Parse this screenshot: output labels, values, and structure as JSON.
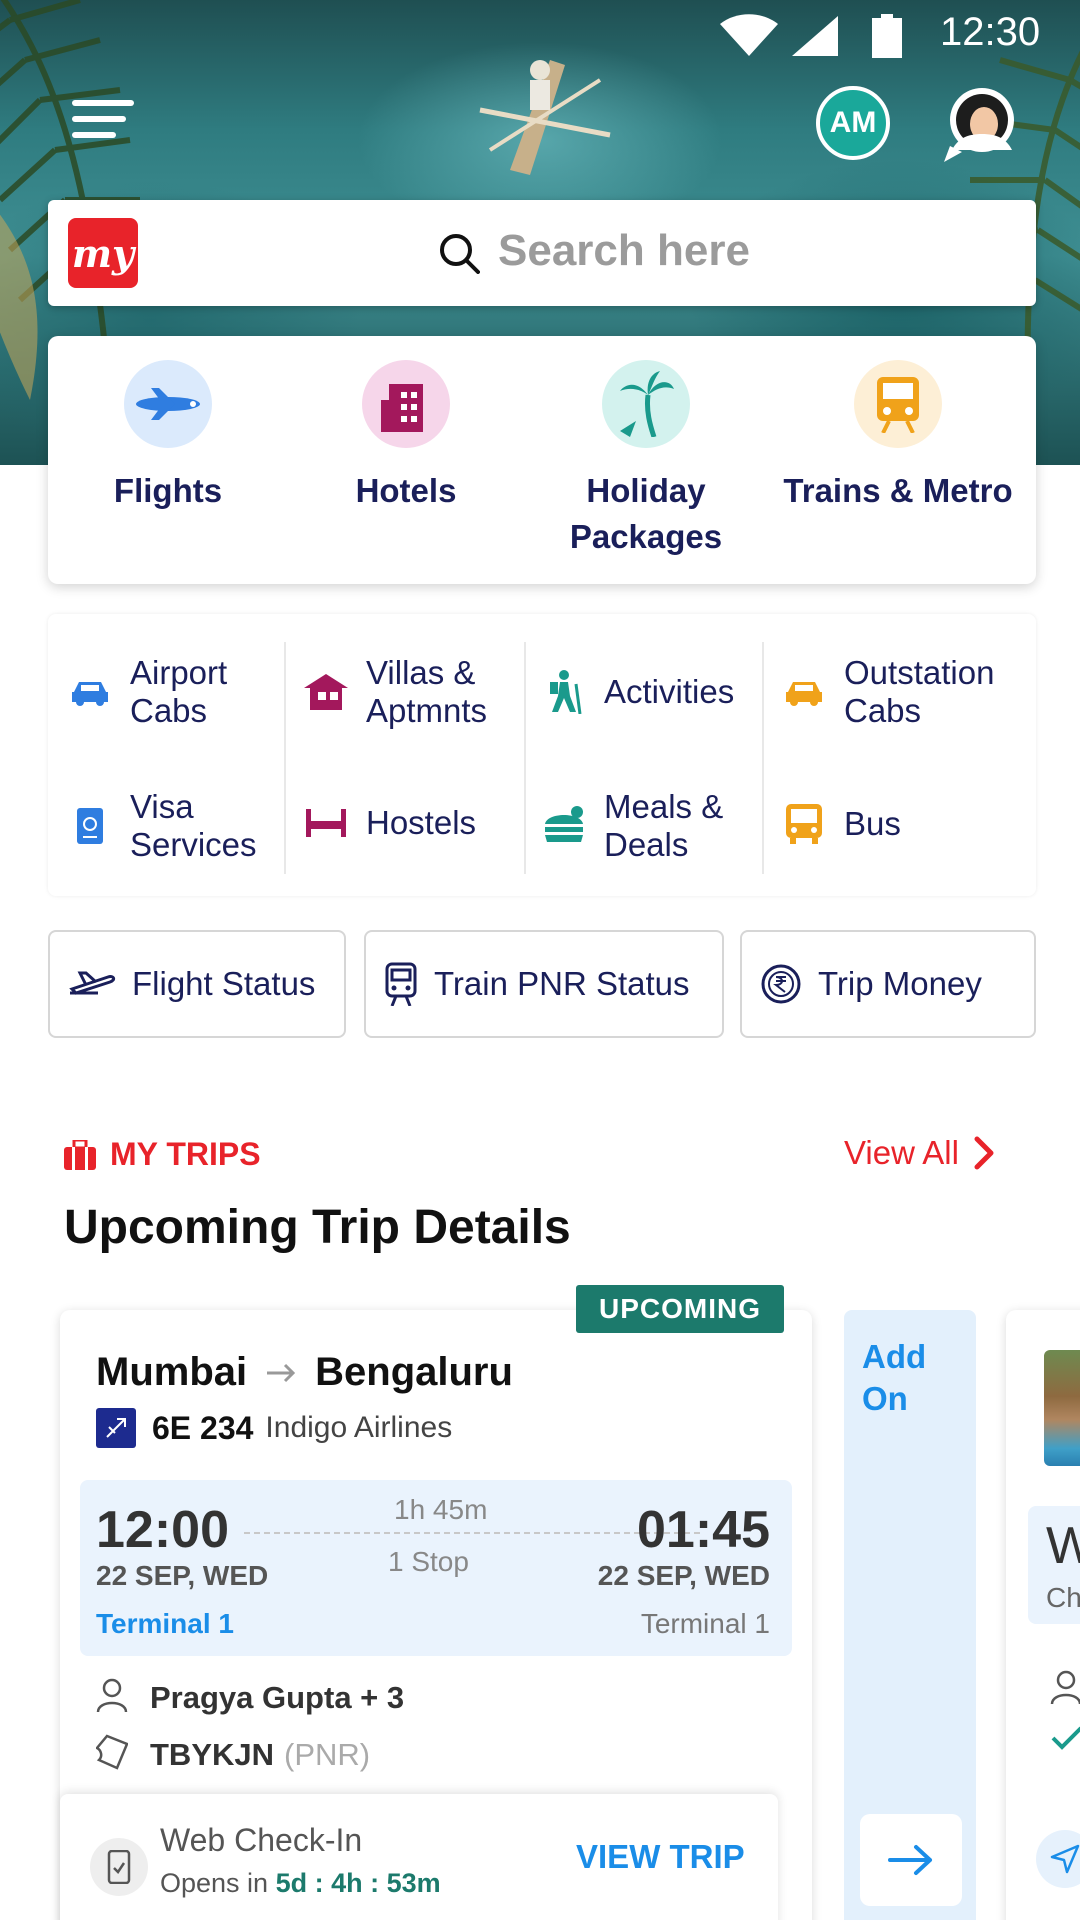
{
  "status_bar": {
    "time": "12:30"
  },
  "header": {
    "avatar_initials": "AM",
    "search": {
      "placeholder": "Search here"
    },
    "logo_text": "my"
  },
  "primary_services": [
    {
      "label": "Flights",
      "icon": "airplane-icon"
    },
    {
      "label": "Hotels",
      "icon": "building-icon"
    },
    {
      "label": "Holiday Packages",
      "icon": "palm-tree-icon"
    },
    {
      "label": "Trains & Metro",
      "icon": "train-icon"
    }
  ],
  "secondary_services": [
    {
      "label": "Airport Cabs",
      "icon": "car-icon"
    },
    {
      "label": "Villas & Aptmnts",
      "icon": "villa-icon"
    },
    {
      "label": "Activities",
      "icon": "hiker-icon"
    },
    {
      "label": "Outstation Cabs",
      "icon": "car-icon"
    },
    {
      "label": "Visa Services",
      "icon": "passport-icon"
    },
    {
      "label": "Hostels",
      "icon": "bed-icon"
    },
    {
      "label": "Meals & Deals",
      "icon": "burger-icon"
    },
    {
      "label": "Bus",
      "icon": "bus-icon"
    }
  ],
  "quick_links": [
    {
      "label": "Flight Status",
      "icon": "flight-status-icon"
    },
    {
      "label": "Train PNR Status",
      "icon": "train-icon"
    },
    {
      "label": "Trip Money",
      "icon": "rupee-icon"
    }
  ],
  "my_trips": {
    "kicker": "MY TRIPS",
    "view_all": "View All",
    "title": "Upcoming Trip Details",
    "trip": {
      "badge": "UPCOMING",
      "from": "Mumbai",
      "to": "Bengaluru",
      "flight_no": "6E 234",
      "airline": "Indigo Airlines",
      "departure": {
        "time": "12:00",
        "date": "22 SEP, WED",
        "terminal": "Terminal 1"
      },
      "arrival": {
        "time": "01:45",
        "date": "22 SEP, WED",
        "terminal": "Terminal 1"
      },
      "duration": "1h 45m",
      "stops": "1 Stop",
      "passengers": "Pragya Gupta + 3",
      "pnr": "TBYKJN",
      "pnr_label": "(PNR)",
      "checkin": {
        "title": "Web Check-In",
        "opens_prefix": "Opens in",
        "opens_in": "5d : 4h : 53m",
        "action": "VIEW TRIP"
      }
    },
    "addon": {
      "label": "Add On"
    },
    "next_card": {
      "title_fragment": "W",
      "subtitle_fragment": "Ch"
    }
  },
  "colors": {
    "brand_red": "#e8232a",
    "navy": "#1a1f5a",
    "link_blue": "#1a8de8",
    "upcoming_green": "#1c7a6c"
  }
}
